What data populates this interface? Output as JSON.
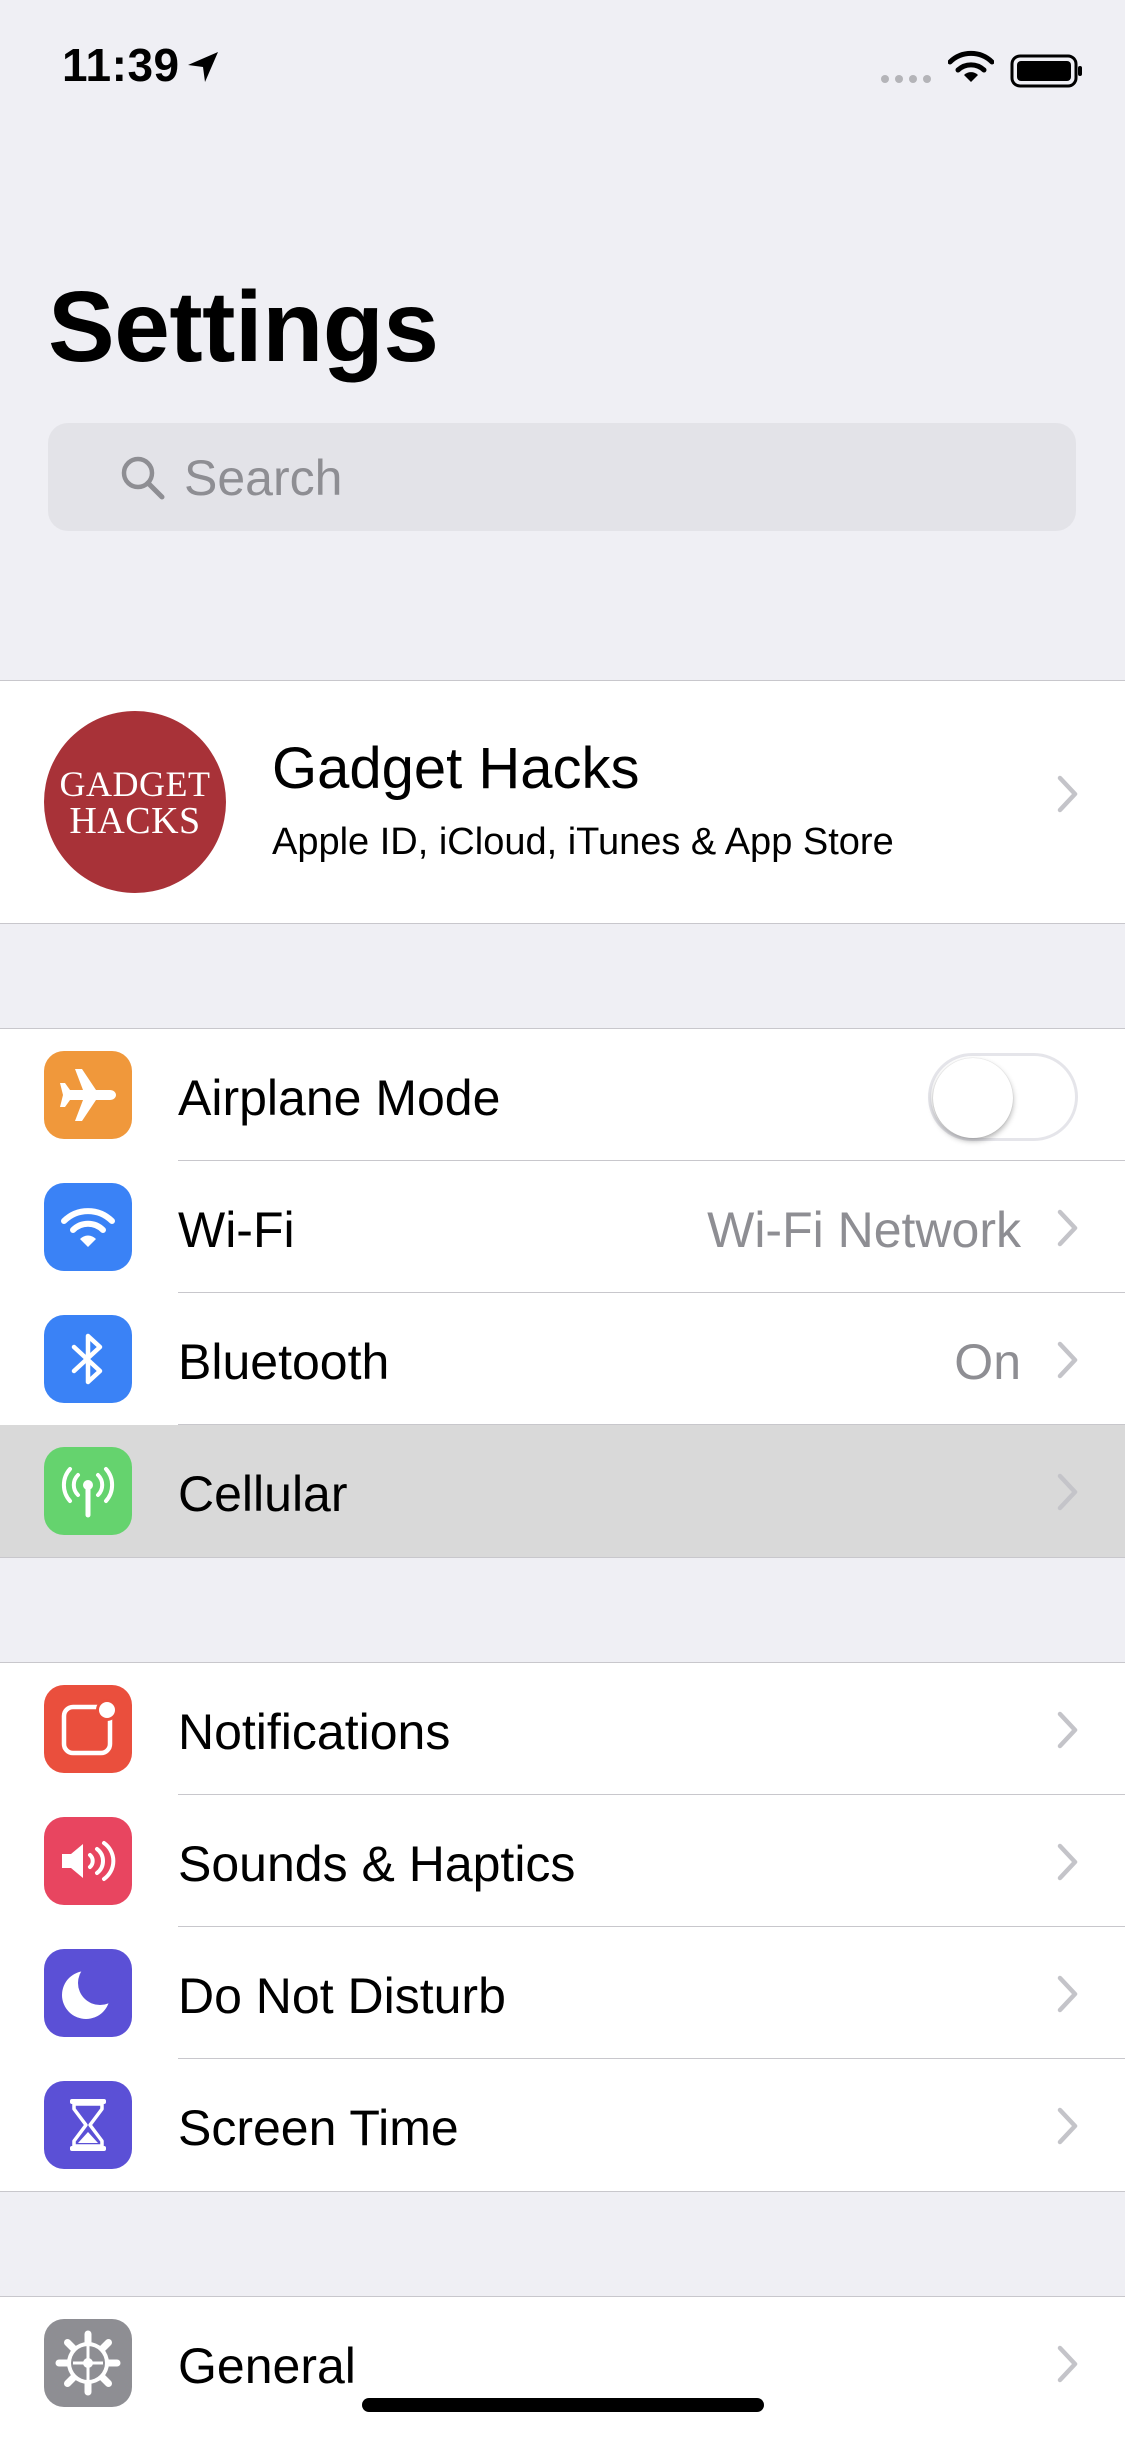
{
  "status": {
    "time": "11:39"
  },
  "header": {
    "title": "Settings"
  },
  "search": {
    "placeholder": "Search"
  },
  "profile": {
    "name": "Gadget Hacks",
    "subtitle": "Apple ID, iCloud, iTunes & App Store",
    "avatar_line1": "GADGET",
    "avatar_line2": "HACKS",
    "avatar_color": "#a83238"
  },
  "connectivity": {
    "airplane": {
      "label": "Airplane Mode",
      "toggle_on": false,
      "icon": "airplane-icon",
      "color": "#f0983b"
    },
    "wifi": {
      "label": "Wi-Fi",
      "value": "Wi-Fi Network",
      "icon": "wifi-icon",
      "color": "#3a82f6"
    },
    "bluetooth": {
      "label": "Bluetooth",
      "value": "On",
      "icon": "bluetooth-icon",
      "color": "#3a82f6"
    },
    "cellular": {
      "label": "Cellular",
      "icon": "antenna-icon",
      "color": "#65d36e"
    }
  },
  "alerts": {
    "notifications": {
      "label": "Notifications",
      "icon": "notifications-icon",
      "color": "#ea4f3d"
    },
    "sounds": {
      "label": "Sounds & Haptics",
      "icon": "speaker-icon",
      "color": "#e84560"
    },
    "dnd": {
      "label": "Do Not Disturb",
      "icon": "moon-icon",
      "color": "#5b50d6"
    },
    "screen_time": {
      "label": "Screen Time",
      "icon": "hourglass-icon",
      "color": "#5b50d6"
    }
  },
  "system": {
    "general": {
      "label": "General",
      "icon": "gear-icon",
      "color": "#8e8e93"
    }
  }
}
